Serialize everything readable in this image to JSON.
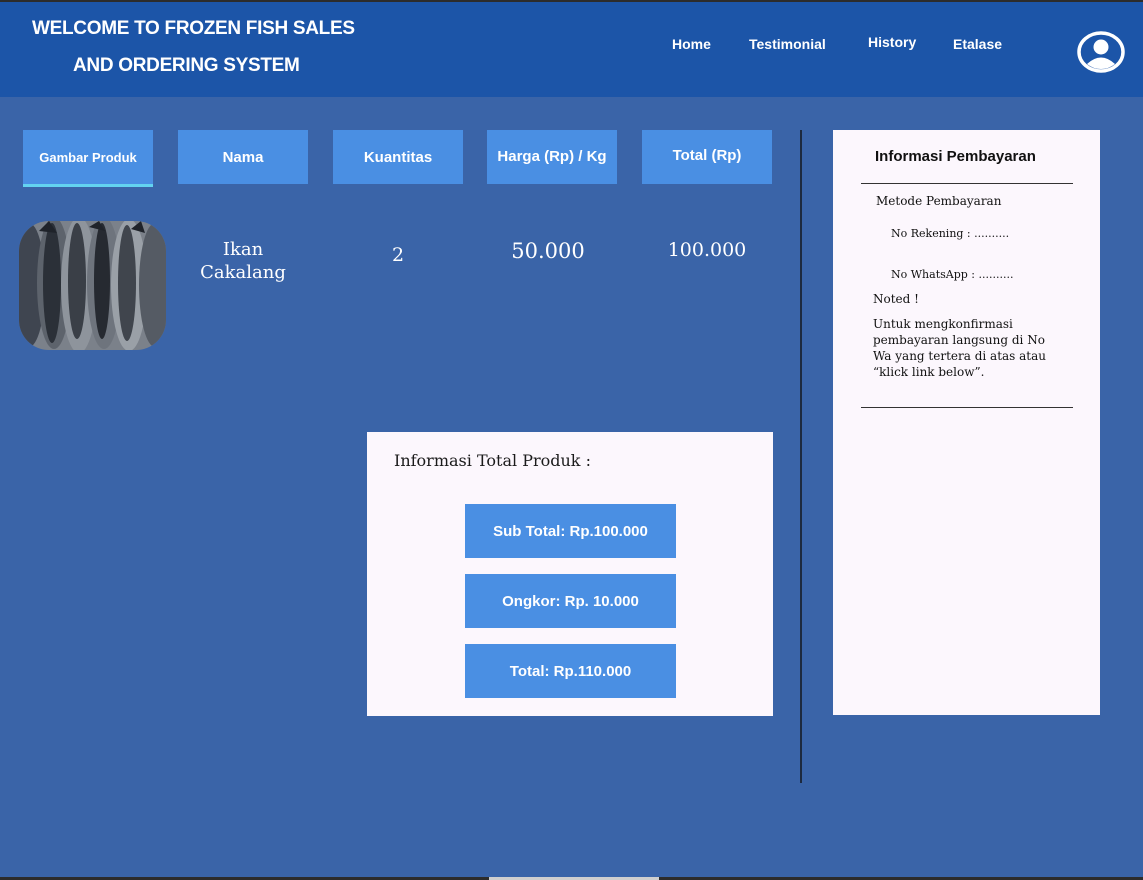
{
  "header": {
    "title_line1": "WELCOME TO FROZEN FISH SALES",
    "title_line2": "AND ORDERING SYSTEM",
    "nav": [
      {
        "label": "Home"
      },
      {
        "label": "Testimonial"
      },
      {
        "label": "History"
      },
      {
        "label": "Etalase"
      }
    ],
    "profile_icon": "user-circle-icon"
  },
  "table": {
    "columns": [
      "Gambar Produk",
      "Nama",
      "Kuantitas",
      "Harga (Rp) / Kg",
      "Total (Rp)"
    ],
    "rows": [
      {
        "image_icon": "fish-photo",
        "name_line1": "Ikan",
        "name_line2": "Cakalang",
        "quantity": "2",
        "price": "50.000",
        "total": "100.000"
      }
    ]
  },
  "summary": {
    "title": "Informasi Total Produk :",
    "subtotal": "Sub Total: Rp.100.000",
    "shipping": "Ongkor: Rp. 10.000",
    "total": "Total: Rp.110.000"
  },
  "payment": {
    "title": "Informasi Pembayaran",
    "method_label": "Metode Pembayaran",
    "account": "No Rekening : ..........",
    "whatsapp": "No WhatsApp : ..........",
    "noted": "Noted !",
    "note": "Untuk mengkonfirmasi pembayaran langsung di No Wa yang tertera di atas atau “klick link below”."
  },
  "colors": {
    "background": "#3a64a8",
    "topbar": "#1c55a8",
    "button": "#4a8fe3",
    "panel": "#fcf7fd"
  }
}
